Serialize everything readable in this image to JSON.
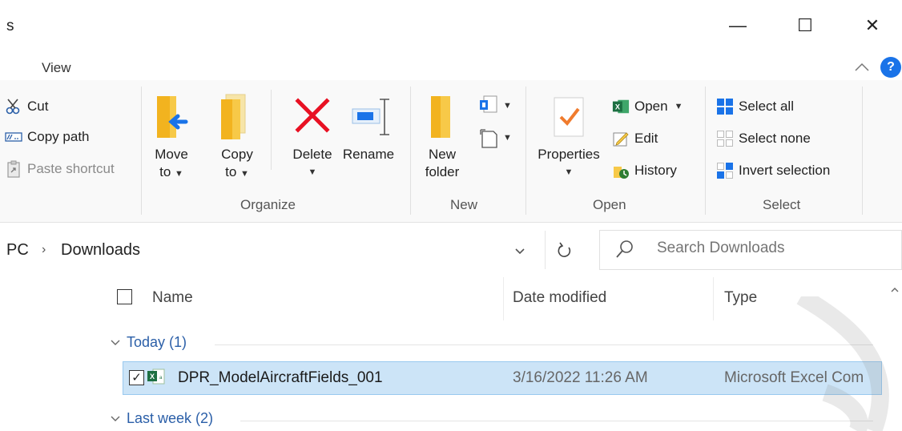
{
  "window": {
    "title": "s",
    "minimize": "—",
    "maximize": "☐",
    "close": "✕"
  },
  "ribbon_tabs": {
    "view": "View"
  },
  "ribbon": {
    "clipboard": {
      "cut": "Cut",
      "copy_path": "Copy path",
      "paste_shortcut": "Paste shortcut"
    },
    "organize": {
      "move_to_l1": "Move",
      "move_to_l2": "to",
      "copy_to_l1": "Copy",
      "copy_to_l2": "to",
      "delete": "Delete",
      "rename": "Rename",
      "label": "Organize"
    },
    "new": {
      "new_folder_l1": "New",
      "new_folder_l2": "folder",
      "label": "New"
    },
    "open": {
      "properties": "Properties",
      "open": "Open",
      "edit": "Edit",
      "history": "History",
      "label": "Open"
    },
    "select": {
      "select_all": "Select all",
      "select_none": "Select none",
      "invert_selection": "Invert selection",
      "label": "Select"
    }
  },
  "address": {
    "crumbs": [
      "PC",
      "Downloads"
    ],
    "separator": "›",
    "search_placeholder": "Search Downloads"
  },
  "columns": {
    "name": "Name",
    "date_modified": "Date modified",
    "type": "Type"
  },
  "groups": [
    {
      "label": "Today (1)",
      "files": [
        {
          "name": "DPR_ModelAircraftFields_001",
          "date": "3/16/2022 11:26 AM",
          "type": "Microsoft Excel Com",
          "selected": true
        }
      ]
    },
    {
      "label": "Last week (2)",
      "files": []
    }
  ],
  "colors": {
    "accent": "#1a73e8",
    "selection_bg": "#cce4f7",
    "selection_border": "#99c9ef",
    "excel_green": "#1d6f42",
    "folder_yellow": "#f7c948",
    "delete_red": "#e81123"
  }
}
